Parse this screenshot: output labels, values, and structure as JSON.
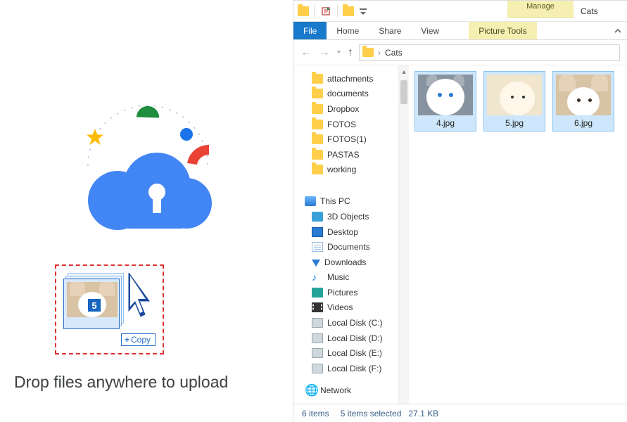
{
  "upload": {
    "caption": "Drop files anywhere to upload",
    "drag_badge_count": "5",
    "drag_cursor_label": "Copy"
  },
  "explorer": {
    "titlebar": {
      "manage_label": "Manage",
      "window_title": "Cats"
    },
    "ribbon": {
      "file": "File",
      "home": "Home",
      "share": "Share",
      "view": "View",
      "context_tab": "Picture Tools"
    },
    "address": {
      "crumb": "Cats"
    },
    "nav_folders": [
      "attachments",
      "documents",
      "Dropbox",
      "FOTOS",
      "FOTOS(1)",
      "PASTAS",
      "working"
    ],
    "nav_pc_label": "This PC",
    "nav_pc_items": [
      {
        "icon": "obj3d",
        "label": "3D Objects"
      },
      {
        "icon": "desktop",
        "label": "Desktop"
      },
      {
        "icon": "docs",
        "label": "Documents"
      },
      {
        "icon": "down",
        "label": "Downloads"
      },
      {
        "icon": "music",
        "label": "Music"
      },
      {
        "icon": "pics",
        "label": "Pictures"
      },
      {
        "icon": "vids",
        "label": "Videos"
      },
      {
        "icon": "disk",
        "label": "Local Disk (C:)"
      },
      {
        "icon": "disk",
        "label": "Local Disk (D:)"
      },
      {
        "icon": "disk",
        "label": "Local Disk (E:)"
      },
      {
        "icon": "disk",
        "label": "Local Disk (F:)"
      }
    ],
    "nav_network_label": "Network",
    "files": [
      {
        "name": "4.jpg",
        "thumb": "cat4",
        "selected": true
      },
      {
        "name": "5.jpg",
        "thumb": "cat5",
        "selected": true
      },
      {
        "name": "6.jpg",
        "thumb": "cat6",
        "selected": true
      }
    ],
    "status": {
      "item_count": "6 items",
      "selection": "5 items selected",
      "size": "27.1 KB"
    }
  }
}
